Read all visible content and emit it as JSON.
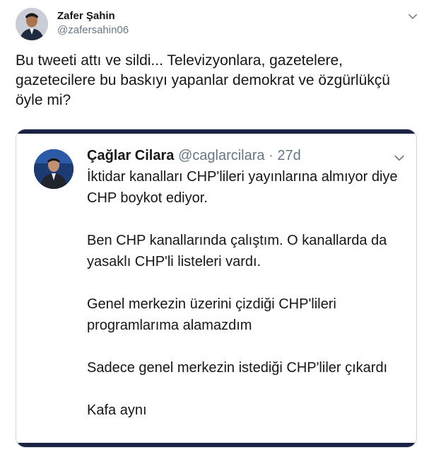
{
  "author": {
    "name": "Zafer Şahin",
    "handle": "@zafersahin06",
    "avatar_icon": "profile-photo-icon"
  },
  "tweet": {
    "text": "Bu tweeti attı ve sildi... Televizyonlara, gazetelere, gazetecilere bu baskıyı yapanlar demokrat ve özgürlükçü öyle mi?"
  },
  "quoted": {
    "name": "Çağlar Cilara",
    "handle": "@caglarcilara",
    "separator": "·",
    "time": "27d",
    "text": "İktidar kanalları CHP'lileri yayınlarına almıyor diye CHP boykot ediyor.\n\nBen CHP kanallarında çalıştım. O kanallarda da yasaklı CHP'li listeleri vardı.\n\nGenel merkezin üzerini çizdiği CHP'lileri programlarıma alamazdım\n\nSadece genel merkezin istediği CHP'liler çıkardı\n\nKafa aynı",
    "avatar_icon": "profile-photo-icon"
  },
  "colors": {
    "text": "#14171a",
    "secondary": "#657786",
    "border": "#ccd6dd",
    "card_bar": "#1a2344"
  }
}
